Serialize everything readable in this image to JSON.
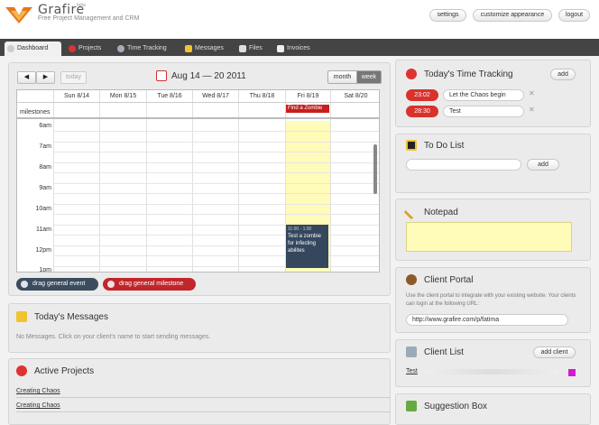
{
  "app": {
    "name": "Grafire",
    "badge": "beta",
    "tagline": "Free Project Management and CRM"
  },
  "header": {
    "settings": "settings",
    "customize": "customize appearance",
    "logout": "logout"
  },
  "tabs": [
    {
      "label": "Dashboard",
      "icon": "dashboard-icon",
      "active": true
    },
    {
      "label": "Projects",
      "icon": "target-icon",
      "active": false
    },
    {
      "label": "Time Tracking",
      "icon": "stopwatch-icon",
      "active": false
    },
    {
      "label": "Messages",
      "icon": "envelope-icon",
      "active": false
    },
    {
      "label": "Files",
      "icon": "file-icon",
      "active": false
    },
    {
      "label": "Invoices",
      "icon": "invoice-icon",
      "active": false
    }
  ],
  "calendar": {
    "prev": "◀",
    "next": "▶",
    "today": "today",
    "range": "Aug 14 — 20 2011",
    "month": "month",
    "week": "week",
    "days": [
      "Sun 8/14",
      "Mon 8/15",
      "Tue 8/16",
      "Wed 8/17",
      "Thu 8/18",
      "Fri 8/19",
      "Sat 8/20"
    ],
    "milestones_label": "milestones",
    "times": [
      "6am",
      "7am",
      "8am",
      "9am",
      "10am",
      "11am",
      "12pm",
      "1pm"
    ],
    "milestone": "Find a Zombie",
    "event": {
      "time": "11:00 - 1:00",
      "title": "Test a zombie for infecting abilites"
    },
    "drag_event": "drag general event",
    "drag_milestone": "drag general milestone"
  },
  "messages": {
    "title": "Today's Messages",
    "empty": "No Messages. Click on your client's name to start sending messages."
  },
  "projects": {
    "title": "Active Projects",
    "items": [
      "Creating Chaos",
      "Creating Chaos"
    ]
  },
  "time_tracking": {
    "title": "Today's Time Tracking",
    "add": "add",
    "entries": [
      {
        "time": "23:02",
        "label": "Let the Chaos begin"
      },
      {
        "time": "28:30",
        "label": "Test"
      }
    ]
  },
  "todo": {
    "title": "To Do List",
    "add": "add"
  },
  "notepad": {
    "title": "Notepad"
  },
  "portal": {
    "title": "Client Portal",
    "text": "Use the client portal to integrate with your existing website. Your clients can login at the following URL:",
    "url": "http://www.grafire.com/p/fatima"
  },
  "clients": {
    "title": "Client List",
    "add": "add client",
    "items": [
      "Test"
    ],
    "swatch_color": "#d21ad2"
  },
  "suggestion": {
    "title": "Suggestion Box"
  }
}
